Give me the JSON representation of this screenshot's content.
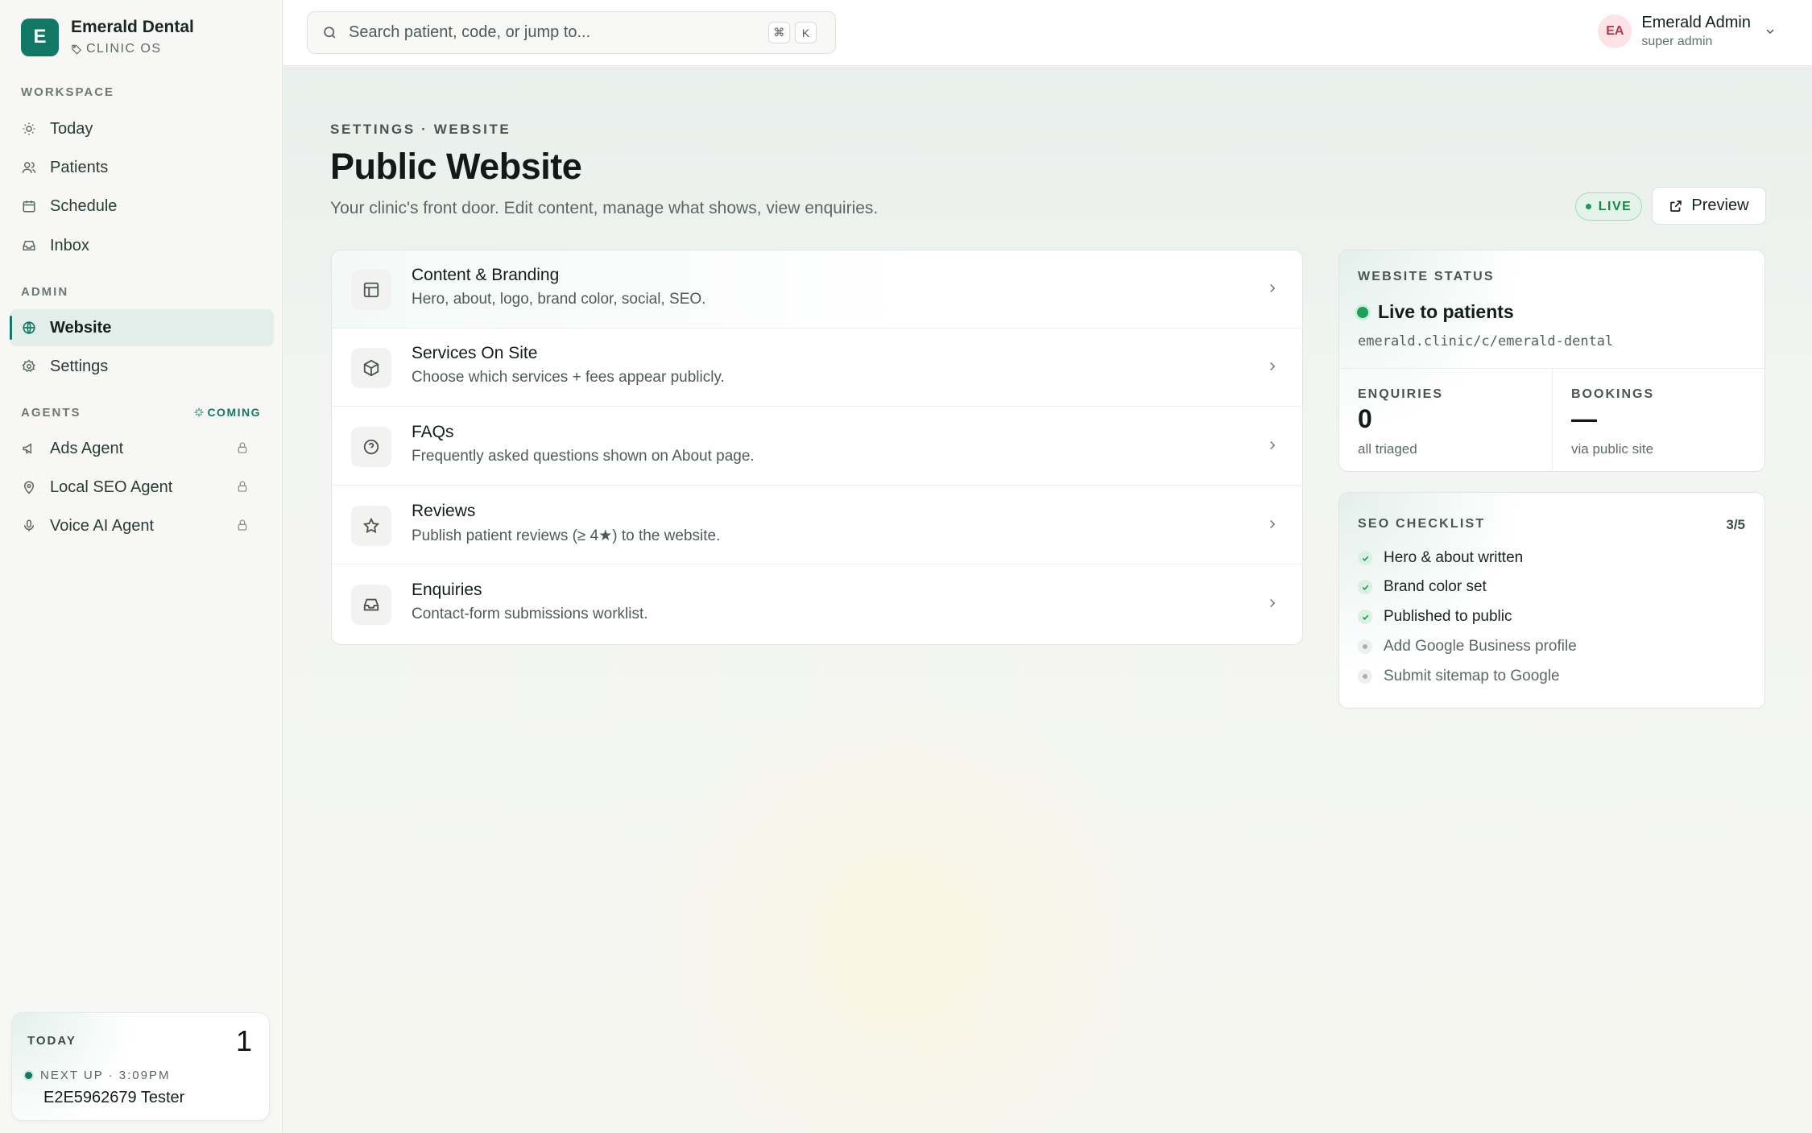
{
  "brand": {
    "initial": "E",
    "name": "Emerald Dental",
    "subtitle": "CLINIC OS"
  },
  "sidebar": {
    "workspace_label": "WORKSPACE",
    "workspace_items": [
      {
        "label": "Today",
        "icon": "sun-icon"
      },
      {
        "label": "Patients",
        "icon": "users-icon"
      },
      {
        "label": "Schedule",
        "icon": "calendar-icon"
      },
      {
        "label": "Inbox",
        "icon": "inbox-icon"
      }
    ],
    "admin_label": "ADMIN",
    "admin_items": [
      {
        "label": "Website",
        "icon": "globe-icon",
        "active": true
      },
      {
        "label": "Settings",
        "icon": "gear-icon"
      }
    ],
    "agents_label": "AGENTS",
    "agents_coming": "COMING",
    "agent_items": [
      {
        "label": "Ads Agent",
        "icon": "megaphone-icon",
        "locked": true
      },
      {
        "label": "Local SEO Agent",
        "icon": "map-pin-icon",
        "locked": true
      },
      {
        "label": "Voice AI Agent",
        "icon": "microphone-icon",
        "locked": true
      }
    ],
    "today_card": {
      "label": "TODAY",
      "count": "1",
      "next_up": "NEXT UP · 3:09PM",
      "patient": "E2E5962679 Tester"
    }
  },
  "topbar": {
    "search_placeholder": "Search patient, code, or jump to...",
    "shortcut_keys": [
      "⌘",
      "K"
    ],
    "user": {
      "initials": "EA",
      "name": "Emerald Admin",
      "role": "super admin"
    }
  },
  "page": {
    "breadcrumb": "SETTINGS · WEBSITE",
    "title": "Public Website",
    "subtitle": "Your clinic's front door. Edit content, manage what shows, view enquiries.",
    "live_badge": "LIVE",
    "preview_label": "Preview"
  },
  "sections": [
    {
      "title": "Content & Branding",
      "desc": "Hero, about, logo, brand color, social, SEO.",
      "icon": "layout-icon"
    },
    {
      "title": "Services On Site",
      "desc": "Choose which services + fees appear publicly.",
      "icon": "box-icon"
    },
    {
      "title": "FAQs",
      "desc": "Frequently asked questions shown on About page.",
      "icon": "help-circle-icon"
    },
    {
      "title": "Reviews",
      "desc": "Publish patient reviews (≥ 4★) to the website.",
      "icon": "star-icon"
    },
    {
      "title": "Enquiries",
      "desc": "Contact-form submissions worklist.",
      "icon": "inbox-icon"
    }
  ],
  "website_status": {
    "label": "WEBSITE STATUS",
    "status": "Live to patients",
    "url": "emerald.clinic/c/emerald-dental",
    "enquiries": {
      "label": "ENQUIRIES",
      "value": "0",
      "sub": "all triaged"
    },
    "bookings": {
      "label": "BOOKINGS",
      "value": "—",
      "sub": "via public site"
    }
  },
  "seo_checklist": {
    "label": "SEO CHECKLIST",
    "count": "3/5",
    "items": [
      {
        "label": "Hero & about written",
        "done": true
      },
      {
        "label": "Brand color set",
        "done": true
      },
      {
        "label": "Published to public",
        "done": true
      },
      {
        "label": "Add Google Business profile",
        "done": false
      },
      {
        "label": "Submit sitemap to Google",
        "done": false
      }
    ]
  },
  "colors": {
    "accent": "#117866",
    "live_green": "#1f9e5c",
    "avatar_bg": "#fbe3e6"
  }
}
